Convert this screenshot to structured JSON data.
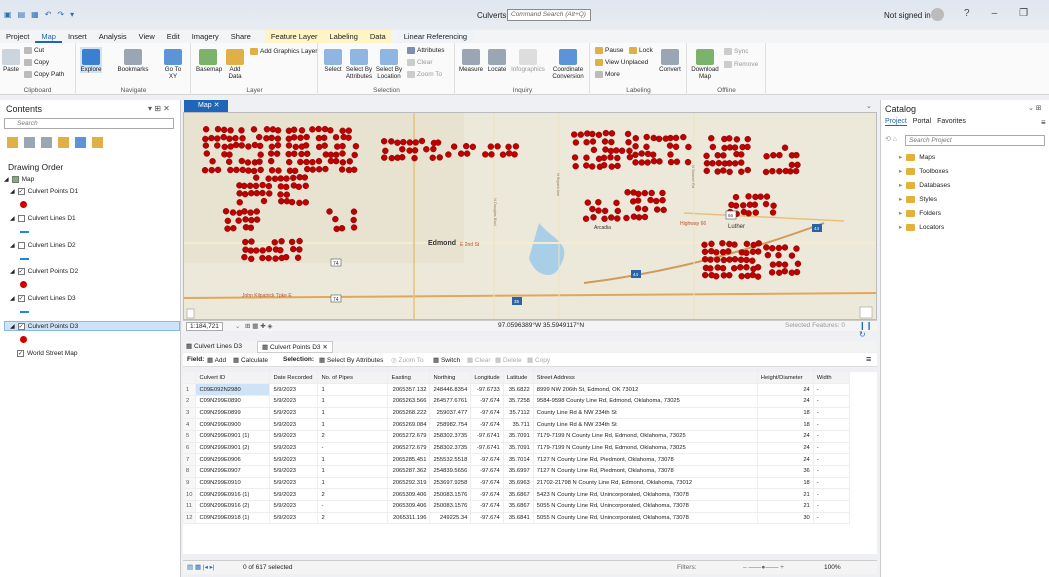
{
  "app": {
    "title": "Culverts",
    "command_search_placeholder": "Command Search (Alt+Q)",
    "signin": "Not signed in",
    "help": "?",
    "minimize": "–",
    "restore": "❐",
    "close": "✕"
  },
  "ribbon_tabs": [
    "Project",
    "Map",
    "Insert",
    "Analysis",
    "View",
    "Edit",
    "Imagery",
    "Share",
    "Feature Layer",
    "Labeling",
    "Data",
    "Linear Referencing"
  ],
  "ribbon": {
    "clipboard": {
      "name": "Clipboard",
      "paste": "Paste",
      "cut": "Cut",
      "copy": "Copy",
      "copy_path": "Copy Path"
    },
    "navigate": {
      "name": "Navigate",
      "explore": "Explore",
      "bookmarks": "Bookmarks",
      "goto": "Go To XY"
    },
    "layer": {
      "name": "Layer",
      "basemap": "Basemap",
      "add_data": "Add Data",
      "add_graphics": "Add Graphics Layer"
    },
    "selection": {
      "name": "Selection",
      "select": "Select",
      "by_attr": "Select By Attributes",
      "by_loc": "Select By Location",
      "attributes": "Attributes",
      "clear": "Clear",
      "zoom_to": "Zoom To"
    },
    "inquiry": {
      "name": "Inquiry",
      "measure": "Measure",
      "locate": "Locate",
      "infographics": "Infographics",
      "coord": "Coordinate Conversion"
    },
    "labeling": {
      "name": "Labeling",
      "pause": "Pause",
      "lock": "Lock",
      "view_unplaced": "View Unplaced",
      "more": "More",
      "convert": "Convert"
    },
    "offline": {
      "name": "Offline",
      "download": "Download Map",
      "sync": "Sync",
      "remove": "Remove"
    }
  },
  "contents": {
    "title": "Contents",
    "search_placeholder": "Search",
    "drawing_order": "Drawing Order",
    "map_label": "Map",
    "layers": [
      {
        "name": "Culvert Points D1",
        "checked": "✓"
      },
      {
        "name": "Culvert Lines D1",
        "checked": ""
      },
      {
        "name": "Culvert Lines D2",
        "checked": ""
      },
      {
        "name": "Culvert Points D2",
        "checked": "✓"
      },
      {
        "name": "Culvert Lines D3",
        "checked": "✓"
      },
      {
        "name": "Culvert Points D3",
        "checked": "✓"
      }
    ],
    "basemap": "World Street Map"
  },
  "map": {
    "tab": "Map",
    "labels": {
      "edmond": "Edmond",
      "e2nd": "E 2nd St",
      "luther": "Luther",
      "arcadia": "Arcadia",
      "highway66": "Highway 66",
      "kilpatrick": "John Kilpatrick Tpke E",
      "route74a": "74",
      "route74b": "74",
      "int44": "44",
      "int35": "35",
      "us66": "66",
      "douglas": "N Douglas Blvd",
      "bryant": "N Bryant Ave",
      "sooner": "N Sooner Rd",
      "int44b": "44"
    },
    "scale": "1:184,721",
    "coords": "97.0596389°W 35.5949117°N",
    "selected_features": "Selected Features: 0"
  },
  "table": {
    "tabs": [
      "Culvert Lines D3",
      "Culvert Points D3"
    ],
    "toolbar": {
      "field": "Field:",
      "add": "Add",
      "calculate": "Calculate",
      "selection": "Selection:",
      "by_attr": "Select By Attributes",
      "zoom_to": "Zoom To",
      "switch": "Switch",
      "clear": "Clear",
      "delete": "Delete",
      "copy": "Copy"
    },
    "columns": [
      "Culvert ID",
      "Date Recorded",
      "No. of Pipes",
      "Easting",
      "Northing",
      "Longitude",
      "Latitude",
      "Street Address",
      "Height/Diameter",
      "Width"
    ],
    "rows": [
      [
        "1",
        "C09E092N2980",
        "5/9/2023",
        "1",
        "2065357.132",
        "248446.8354",
        "-97.6733",
        "35.6822",
        "8999 NW 206th St, Edmond, OK 73012",
        "24",
        "-"
      ],
      [
        "2",
        "C09N299E0890",
        "5/9/2023",
        "1",
        "2065263.566",
        "264577.6761",
        "-97.674",
        "35.7258",
        "9584-9598 County Line Rd, Edmond, Oklahoma, 73025",
        "24",
        "-"
      ],
      [
        "3",
        "C09N299E0899",
        "5/9/2023",
        "1",
        "2065268.222",
        "259037.477",
        "-97.674",
        "35.7112",
        "County Line Rd & NW 234th St",
        "18",
        "-"
      ],
      [
        "4",
        "C09N299E0900",
        "5/9/2023",
        "1",
        "2065269.084",
        "258982.754",
        "-97.674",
        "35.711",
        "County Line Rd & NW 234th St",
        "18",
        "-"
      ],
      [
        "5",
        "C09N299E0901 (1)",
        "5/9/2023",
        "2",
        "2065272.679",
        "258302.3735",
        "-97.6741",
        "35.7091",
        "7179-7199 N County Line Rd, Edmond, Oklahoma, 73025",
        "24",
        "-"
      ],
      [
        "6",
        "C09N299E0901 (2)",
        "5/9/2023",
        "-",
        "2065272.679",
        "258302.3735",
        "-97.6741",
        "35.7091",
        "7179-7199 N County Line Rd, Edmond, Oklahoma, 73025",
        "24",
        "-"
      ],
      [
        "7",
        "C09N299E0906",
        "5/9/2023",
        "1",
        "2065285.451",
        "255532.5518",
        "-97.674",
        "35.7014",
        "7127 N County Line Rd, Piedmont, Oklahoma, 73078",
        "24",
        "-"
      ],
      [
        "8",
        "C09N299E0907",
        "5/9/2023",
        "1",
        "2065287.362",
        "254839.5656",
        "-97.674",
        "35.6997",
        "7127 N County Line Rd, Piedmont, Oklahoma, 73078",
        "36",
        "-"
      ],
      [
        "9",
        "C09N299E0910",
        "5/9/2023",
        "1",
        "2065292.319",
        "253697.9258",
        "-97.674",
        "35.6963",
        "21702-21798 N County Line Rd, Edmond, Oklahoma, 73012",
        "18",
        "-"
      ],
      [
        "10",
        "C09N299E0916 (1)",
        "5/9/2023",
        "2",
        "2065309.406",
        "250083.1576",
        "-97.674",
        "35.6867",
        "5423 N County Line Rd, Unincorporated, Oklahoma, 73078",
        "21",
        "-"
      ],
      [
        "11",
        "C09N299E0916 (2)",
        "5/9/2023",
        "-",
        "2065309.406",
        "250083.1576",
        "-97.674",
        "35.6867",
        "5055 N County Line Rd, Unincorporated, Oklahoma, 73078",
        "21",
        "-"
      ],
      [
        "12",
        "C09N299E0918 (1)",
        "5/9/2023",
        "2",
        "2065311.196",
        "249225.34",
        "-97.674",
        "35.6841",
        "5055 N County Line Rd, Unincorporated, Oklahoma, 73078",
        "30",
        "-"
      ]
    ],
    "status": "0 of 617 selected",
    "filters": "Filters:",
    "zoom": "100%"
  },
  "catalog": {
    "title": "Catalog",
    "tabs": [
      "Project",
      "Portal",
      "Favorites"
    ],
    "search_placeholder": "Search Project",
    "items": [
      "Maps",
      "Toolboxes",
      "Databases",
      "Styles",
      "Folders",
      "Locators"
    ]
  },
  "colors": {
    "accent": "#1f66b8",
    "point": "#c00000",
    "line": "#1b8bd6"
  }
}
